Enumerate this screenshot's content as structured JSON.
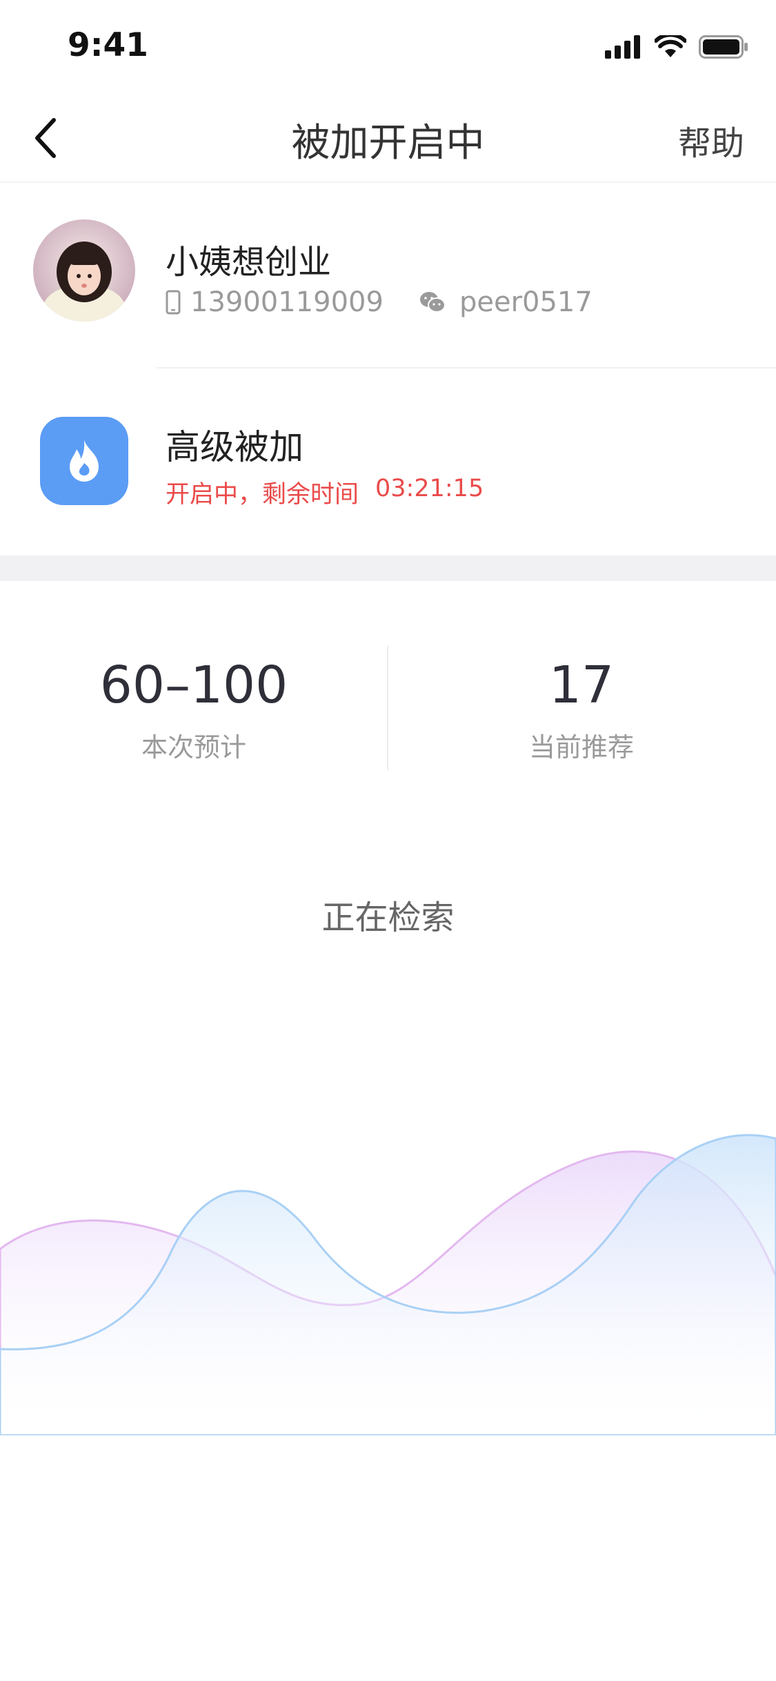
{
  "status_bar": {
    "time": "9:41",
    "icons": [
      "signal-icon",
      "wifi-icon",
      "battery-icon"
    ]
  },
  "nav": {
    "back_icon": "chevron-left-icon",
    "title": "被加开启中",
    "help_label": "帮助"
  },
  "profile": {
    "name": "小姨想创业",
    "phone": "13900119009",
    "wechat": "peer0517",
    "phone_icon": "phone-icon",
    "wechat_icon": "wechat-icon"
  },
  "feature": {
    "icon": "flame-icon",
    "title": "高级被加",
    "status_text": "开启中，剩余时间",
    "countdown": "03:21:15",
    "accent_color": "#5b9cf5",
    "status_color": "#ea4a4a"
  },
  "stats": [
    {
      "value": "60–100",
      "label": "本次预计"
    },
    {
      "value": "17",
      "label": "当前推荐"
    }
  ],
  "searching_text": "正在检索",
  "wave_colors": {
    "blue": "#a9d0f5",
    "purple": "#e6c4f3"
  }
}
